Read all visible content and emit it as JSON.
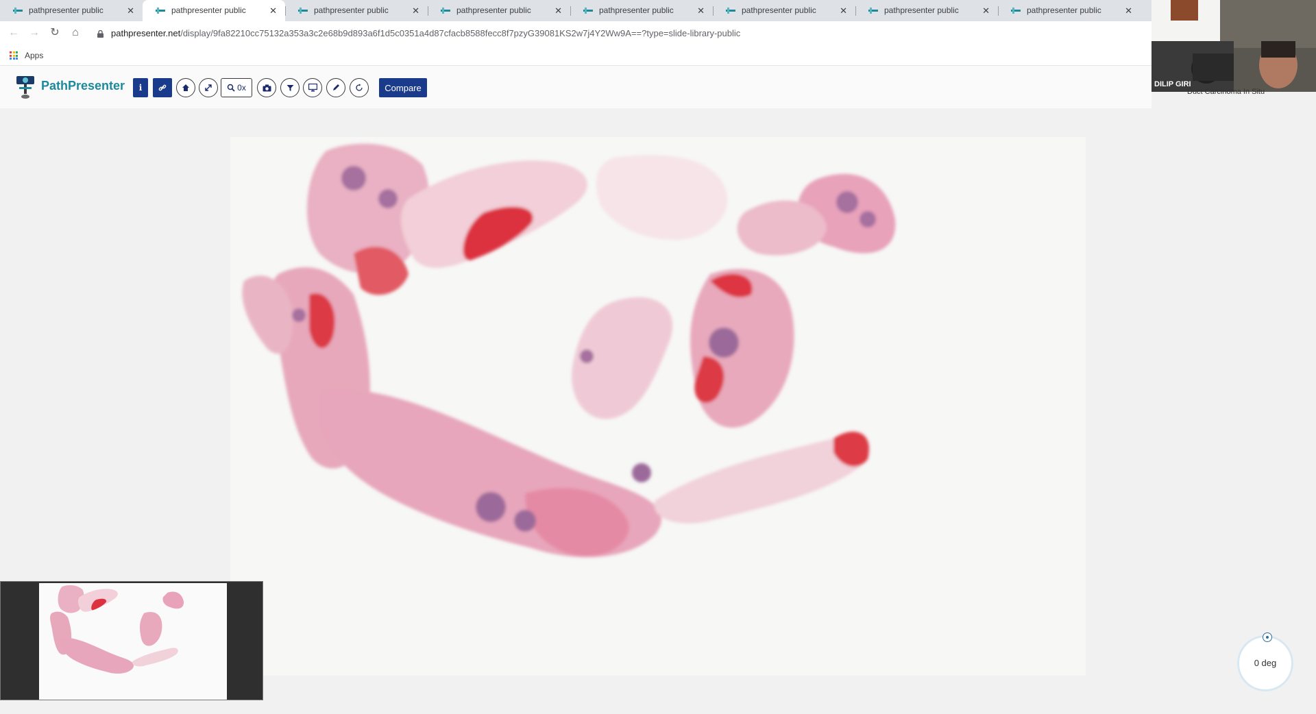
{
  "browser": {
    "tabs": [
      {
        "title": "pathpresenter public",
        "active": false
      },
      {
        "title": "pathpresenter public",
        "active": true
      },
      {
        "title": "pathpresenter public",
        "active": false
      },
      {
        "title": "pathpresenter public",
        "active": false
      },
      {
        "title": "pathpresenter public",
        "active": false
      },
      {
        "title": "pathpresenter public",
        "active": false
      },
      {
        "title": "pathpresenter public",
        "active": false
      },
      {
        "title": "pathpresenter public",
        "active": false
      }
    ],
    "url_host": "pathpresenter.net",
    "url_path": "/display/9fa82210cc75132a353a3c2e68b9d893a6f1d5c0351a4d87cfacb8588fecc8f7pzyG39081KS2w7j4Y2Ww9A==?type=slide-library-public",
    "bookmarks_apps": "Apps"
  },
  "app": {
    "brand": "PathPresenter",
    "zoom_label": "0x",
    "compare_label": "Compare",
    "toolbar_icons": [
      "info-icon",
      "link-icon",
      "home-icon",
      "fullscreen-icon",
      "zoom-icon",
      "camera-icon",
      "filter-icon",
      "monitor-icon",
      "pencil-icon",
      "rotate-icon"
    ]
  },
  "viewer": {
    "rotation_label": "0 deg"
  },
  "webcam": {
    "name": "DILIP GIRI",
    "caption": "Duct Carcinoma In Situ"
  },
  "colors": {
    "brand_teal": "#1b8a9c",
    "button_navy": "#1a3a8c",
    "tissue_pink": "#e8a6b8",
    "blood_red": "#d83a3e",
    "nuclei_purple": "#9c6b9a"
  }
}
